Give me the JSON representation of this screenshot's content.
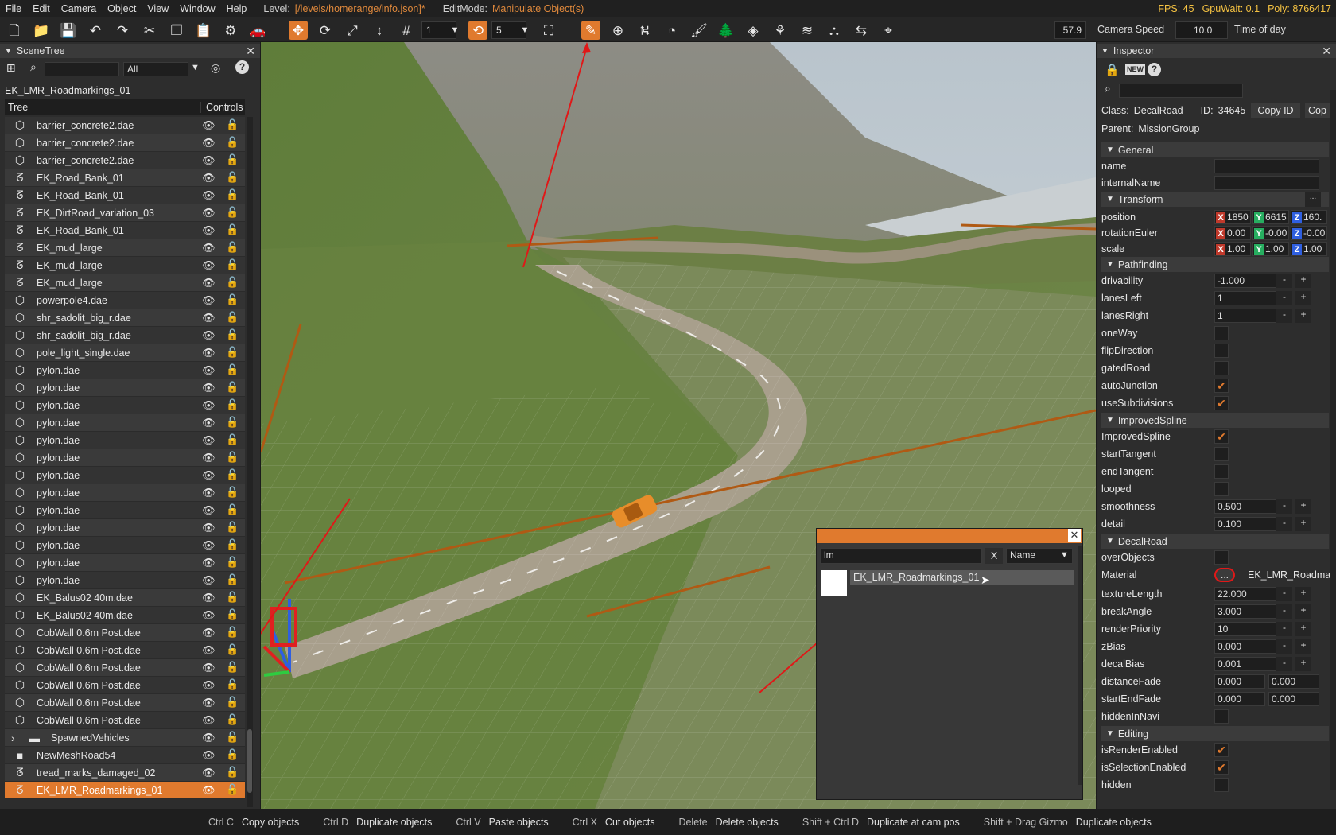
{
  "menubar": {
    "items": [
      "File",
      "Edit",
      "Camera",
      "Object",
      "View",
      "Window",
      "Help"
    ],
    "level_label": "Level:",
    "level_value": "[/levels/homerange/info.json]*",
    "editmode_label": "EditMode:",
    "editmode_value": "Manipulate Object(s)",
    "fps": "FPS: 45",
    "gpuwait": "GpuWait: 0.1",
    "poly": "Poly: 8766417"
  },
  "toolbar": {
    "snap_value_1": "1",
    "snap_value_2": "5",
    "fov_value": "57.9",
    "camera_speed_label": "Camera Speed",
    "camera_speed_value": "10.0",
    "time_of_day_label": "Time of day"
  },
  "scenetree": {
    "title": "SceneTree",
    "filter_value": "All",
    "current_path": "EK_LMR_Roadmarkings_01",
    "col_tree": "Tree",
    "col_controls": "Controls",
    "rows": [
      {
        "label": "barrier_concrete2.dae",
        "icon": "mesh-icon"
      },
      {
        "label": "barrier_concrete2.dae",
        "icon": "mesh-icon"
      },
      {
        "label": "barrier_concrete2.dae",
        "icon": "mesh-icon"
      },
      {
        "label": "EK_Road_Bank_01",
        "icon": "road-icon"
      },
      {
        "label": "EK_Road_Bank_01",
        "icon": "road-icon"
      },
      {
        "label": "EK_DirtRoad_variation_03",
        "icon": "road-icon"
      },
      {
        "label": "EK_Road_Bank_01",
        "icon": "road-icon"
      },
      {
        "label": "EK_mud_large",
        "icon": "road-icon"
      },
      {
        "label": "EK_mud_large",
        "icon": "road-icon"
      },
      {
        "label": "EK_mud_large",
        "icon": "road-icon"
      },
      {
        "label": "powerpole4.dae",
        "icon": "mesh-icon"
      },
      {
        "label": "shr_sadolit_big_r.dae",
        "icon": "mesh-icon"
      },
      {
        "label": "shr_sadolit_big_r.dae",
        "icon": "mesh-icon"
      },
      {
        "label": "pole_light_single.dae",
        "icon": "mesh-icon"
      },
      {
        "label": "pylon.dae",
        "icon": "mesh-icon"
      },
      {
        "label": "pylon.dae",
        "icon": "mesh-icon"
      },
      {
        "label": "pylon.dae",
        "icon": "mesh-icon"
      },
      {
        "label": "pylon.dae",
        "icon": "mesh-icon"
      },
      {
        "label": "pylon.dae",
        "icon": "mesh-icon"
      },
      {
        "label": "pylon.dae",
        "icon": "mesh-icon"
      },
      {
        "label": "pylon.dae",
        "icon": "mesh-icon"
      },
      {
        "label": "pylon.dae",
        "icon": "mesh-icon"
      },
      {
        "label": "pylon.dae",
        "icon": "mesh-icon"
      },
      {
        "label": "pylon.dae",
        "icon": "mesh-icon"
      },
      {
        "label": "pylon.dae",
        "icon": "mesh-icon"
      },
      {
        "label": "pylon.dae",
        "icon": "mesh-icon"
      },
      {
        "label": "pylon.dae",
        "icon": "mesh-icon"
      },
      {
        "label": "EK_Balus02 40m.dae",
        "icon": "mesh-icon"
      },
      {
        "label": "EK_Balus02 40m.dae",
        "icon": "mesh-icon"
      },
      {
        "label": "CobWall 0.6m Post.dae",
        "icon": "mesh-icon"
      },
      {
        "label": "CobWall 0.6m Post.dae",
        "icon": "mesh-icon"
      },
      {
        "label": "CobWall 0.6m Post.dae",
        "icon": "mesh-icon"
      },
      {
        "label": "CobWall 0.6m Post.dae",
        "icon": "mesh-icon"
      },
      {
        "label": "CobWall 0.6m Post.dae",
        "icon": "mesh-icon"
      },
      {
        "label": "CobWall 0.6m Post.dae",
        "icon": "mesh-icon"
      },
      {
        "label": "SpawnedVehicles",
        "icon": "folder-icon"
      },
      {
        "label": "NewMeshRoad54",
        "icon": "square-icon"
      },
      {
        "label": "tread_marks_damaged_02",
        "icon": "road-icon"
      },
      {
        "label": "EK_LMR_Roadmarkings_01",
        "icon": "road-icon",
        "selected": true
      }
    ]
  },
  "inspector": {
    "title": "Inspector",
    "class_label": "Class:",
    "class_value": "DecalRoad",
    "id_label": "ID:",
    "id_value": "34645",
    "copy_id": "Copy ID",
    "copy_2": "Cop",
    "parent_label": "Parent:",
    "parent_value": "MissionGroup",
    "sections": {
      "general": "General",
      "transform": "Transform",
      "pathfinding": "Pathfinding",
      "improvedspline": "ImprovedSpline",
      "decalroad": "DecalRoad",
      "editing": "Editing"
    },
    "labels": {
      "name": "name",
      "internalName": "internalName",
      "position": "position",
      "rotationEuler": "rotationEuler",
      "scale": "scale",
      "drivability": "drivability",
      "lanesLeft": "lanesLeft",
      "lanesRight": "lanesRight",
      "oneWay": "oneWay",
      "flipDirection": "flipDirection",
      "gatedRoad": "gatedRoad",
      "autoJunction": "autoJunction",
      "useSubdivisions": "useSubdivisions",
      "improvedSpline": "ImprovedSpline",
      "startTangent": "startTangent",
      "endTangent": "endTangent",
      "looped": "looped",
      "smoothness": "smoothness",
      "detail": "detail",
      "overObjects": "overObjects",
      "material": "Material",
      "textureLength": "textureLength",
      "breakAngle": "breakAngle",
      "renderPriority": "renderPriority",
      "zBias": "zBias",
      "decalBias": "decalBias",
      "distanceFade": "distanceFade",
      "startEndFade": "startEndFade",
      "hiddenInNavi": "hiddenInNavi",
      "isRenderEnabled": "isRenderEnabled",
      "isSelectionEnabled": "isSelectionEnabled",
      "hidden": "hidden"
    },
    "values": {
      "pos_x": "1850",
      "pos_y": "6615",
      "pos_z": "160.",
      "rot_x": "0.00",
      "rot_y": "-0.00",
      "rot_z": "-0.00",
      "scl_x": "1.00",
      "scl_y": "1.00",
      "scl_z": "1.00",
      "drivability": "-1.000",
      "lanesLeft": "1",
      "lanesRight": "1",
      "smoothness": "0.500",
      "detail": "0.100",
      "material_btn": "...",
      "material_value": "EK_LMR_Roadma",
      "textureLength": "22.000",
      "breakAngle": "3.000",
      "renderPriority": "10",
      "zBias": "0.000",
      "decalBias": "0.001",
      "distanceFade_a": "0.000",
      "distanceFade_b": "0.000",
      "startEndFade_a": "0.000",
      "startEndFade_b": "0.000"
    },
    "checks": {
      "autoJunction": true,
      "useSubdivisions": true,
      "improvedSpline": true,
      "isRenderEnabled": true,
      "isSelectionEnabled": true
    }
  },
  "popup": {
    "search_value": "lm",
    "clear_btn": "X",
    "sort_value": "Name",
    "result": "EK_LMR_Roadmarkings_01"
  },
  "statusbar": [
    {
      "key": "Ctrl C",
      "desc": "Copy objects"
    },
    {
      "key": "Ctrl D",
      "desc": "Duplicate objects"
    },
    {
      "key": "Ctrl V",
      "desc": "Paste objects"
    },
    {
      "key": "Ctrl X",
      "desc": "Cut objects"
    },
    {
      "key": "Delete",
      "desc": "Delete objects"
    },
    {
      "key": "Shift + Ctrl D",
      "desc": "Duplicate at cam pos"
    },
    {
      "key": "Shift + Drag Gizmo",
      "desc": "Duplicate objects"
    }
  ],
  "colors": {
    "accent": "#e07a2e",
    "panel": "#2d2d2d",
    "highlight_fps": "#f5c242"
  }
}
